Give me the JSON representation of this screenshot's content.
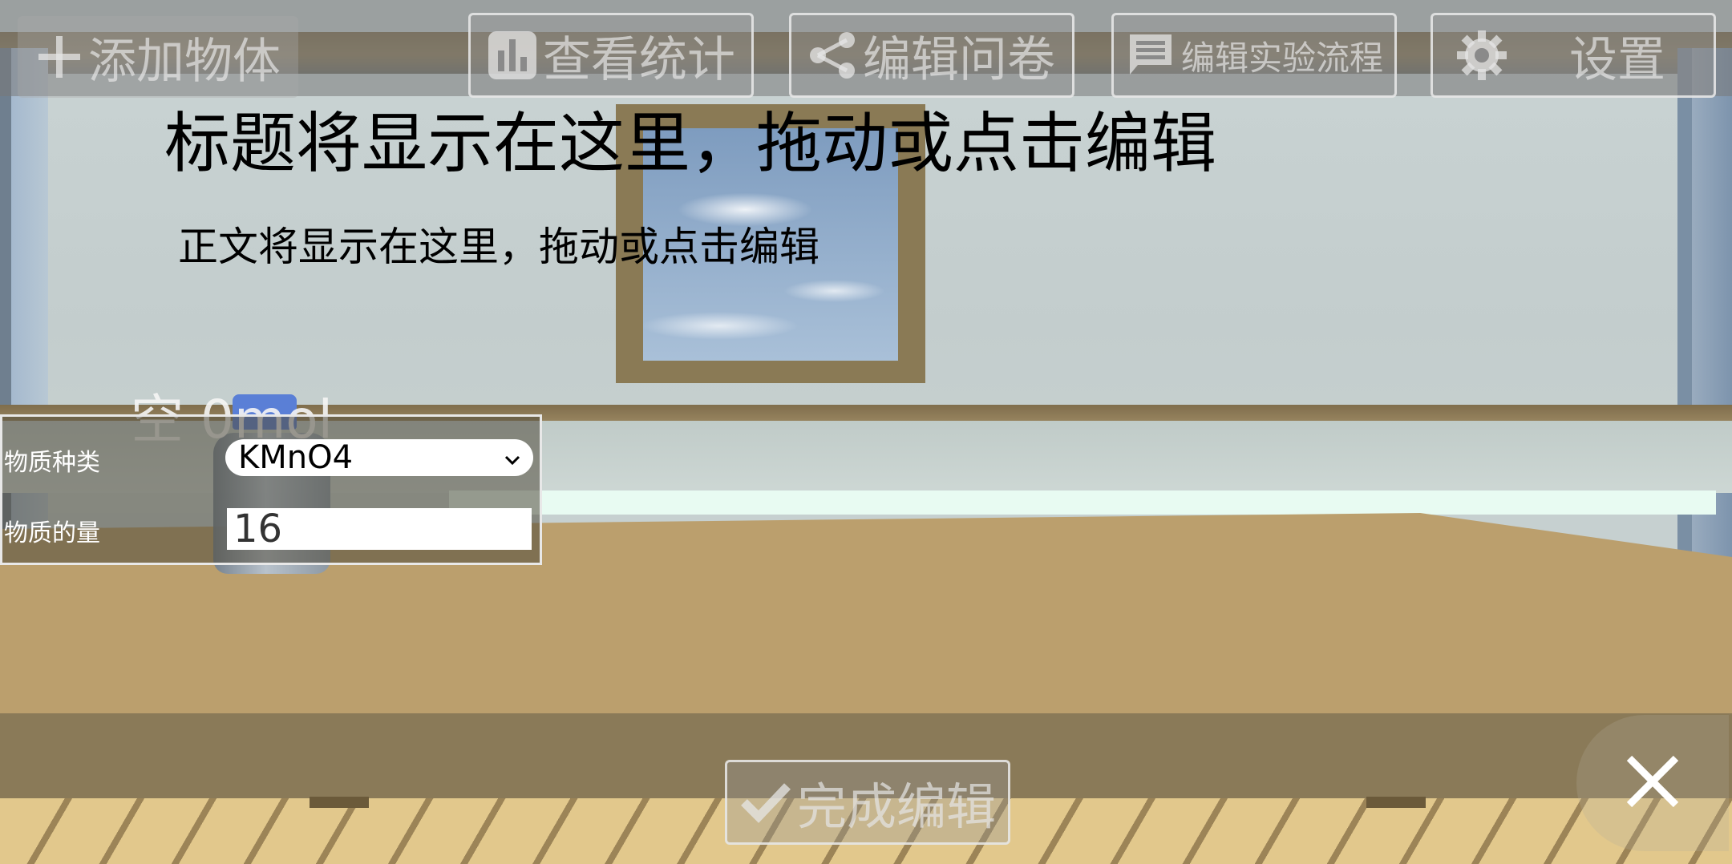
{
  "toolbar": {
    "add_object": "添加物体",
    "view_stats": "查看统计",
    "edit_questionnaire": "编辑问卷",
    "edit_flow": "编辑实验流程",
    "settings": "设置"
  },
  "content": {
    "title": "标题将显示在这里，拖动或点击编辑",
    "body": "正文将显示在这里，拖动或点击编辑"
  },
  "object": {
    "status": "空 0mol"
  },
  "panel": {
    "type_label": "物质种类",
    "type_value": "KMnO4",
    "amount_label": "物质的量",
    "amount_value": "16"
  },
  "bottom": {
    "done_label": "完成编辑"
  },
  "icons": {
    "add": "plus-icon",
    "stats": "bar-chart-icon",
    "share": "share-icon",
    "flow": "message-icon",
    "settings": "gear-icon",
    "done": "check-icon",
    "close": "close-icon",
    "dropdown": "chevron-down-icon"
  }
}
